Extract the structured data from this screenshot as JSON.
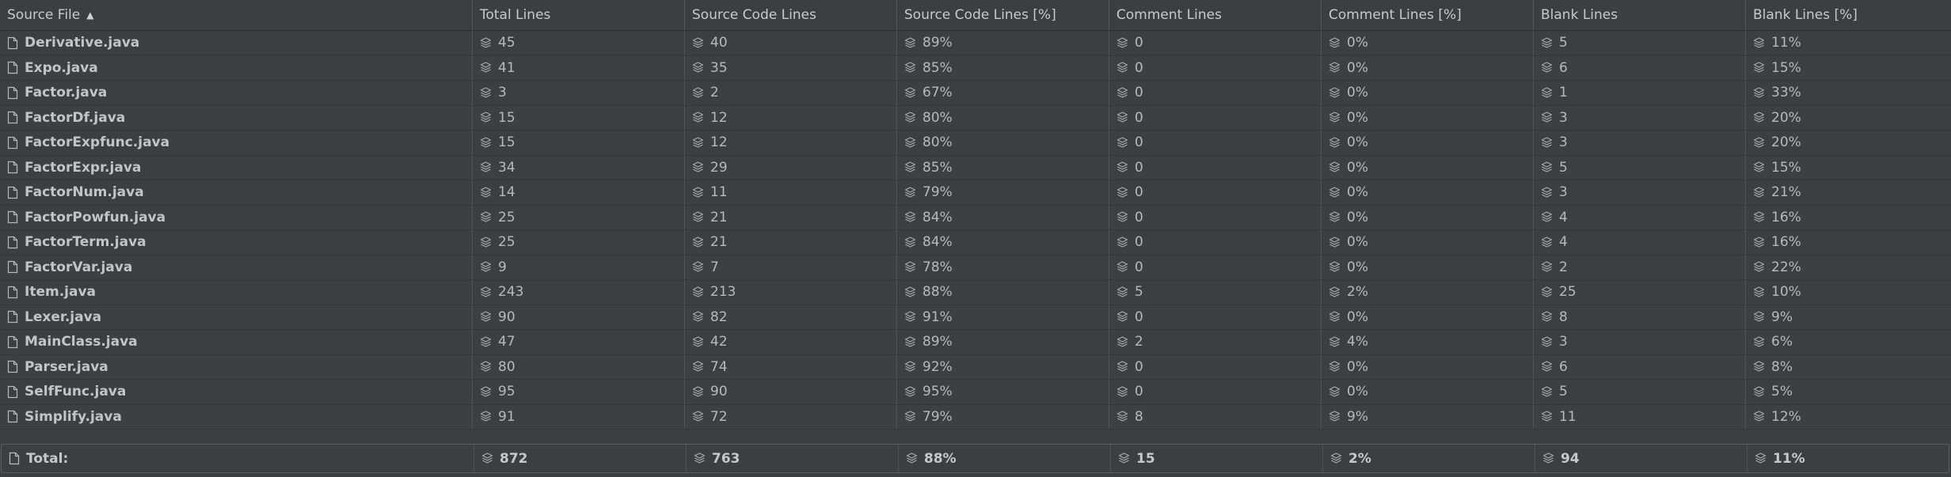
{
  "table": {
    "headers": [
      {
        "label": "Source File",
        "sort": "ascending"
      },
      {
        "label": "Total Lines"
      },
      {
        "label": "Source Code Lines"
      },
      {
        "label": "Source Code Lines [%]"
      },
      {
        "label": "Comment Lines"
      },
      {
        "label": "Comment Lines [%]"
      },
      {
        "label": "Blank Lines"
      },
      {
        "label": "Blank Lines [%]"
      }
    ],
    "rows": [
      {
        "file": "Derivative.java",
        "total": "45",
        "code": "40",
        "code_pct": "89%",
        "comment": "0",
        "comment_pct": "0%",
        "blank": "5",
        "blank_pct": "11%"
      },
      {
        "file": "Expo.java",
        "total": "41",
        "code": "35",
        "code_pct": "85%",
        "comment": "0",
        "comment_pct": "0%",
        "blank": "6",
        "blank_pct": "15%"
      },
      {
        "file": "Factor.java",
        "total": "3",
        "code": "2",
        "code_pct": "67%",
        "comment": "0",
        "comment_pct": "0%",
        "blank": "1",
        "blank_pct": "33%"
      },
      {
        "file": "FactorDf.java",
        "total": "15",
        "code": "12",
        "code_pct": "80%",
        "comment": "0",
        "comment_pct": "0%",
        "blank": "3",
        "blank_pct": "20%"
      },
      {
        "file": "FactorExpfunc.java",
        "total": "15",
        "code": "12",
        "code_pct": "80%",
        "comment": "0",
        "comment_pct": "0%",
        "blank": "3",
        "blank_pct": "20%"
      },
      {
        "file": "FactorExpr.java",
        "total": "34",
        "code": "29",
        "code_pct": "85%",
        "comment": "0",
        "comment_pct": "0%",
        "blank": "5",
        "blank_pct": "15%"
      },
      {
        "file": "FactorNum.java",
        "total": "14",
        "code": "11",
        "code_pct": "79%",
        "comment": "0",
        "comment_pct": "0%",
        "blank": "3",
        "blank_pct": "21%"
      },
      {
        "file": "FactorPowfun.java",
        "total": "25",
        "code": "21",
        "code_pct": "84%",
        "comment": "0",
        "comment_pct": "0%",
        "blank": "4",
        "blank_pct": "16%"
      },
      {
        "file": "FactorTerm.java",
        "total": "25",
        "code": "21",
        "code_pct": "84%",
        "comment": "0",
        "comment_pct": "0%",
        "blank": "4",
        "blank_pct": "16%"
      },
      {
        "file": "FactorVar.java",
        "total": "9",
        "code": "7",
        "code_pct": "78%",
        "comment": "0",
        "comment_pct": "0%",
        "blank": "2",
        "blank_pct": "22%"
      },
      {
        "file": "Item.java",
        "total": "243",
        "code": "213",
        "code_pct": "88%",
        "comment": "5",
        "comment_pct": "2%",
        "blank": "25",
        "blank_pct": "10%"
      },
      {
        "file": "Lexer.java",
        "total": "90",
        "code": "82",
        "code_pct": "91%",
        "comment": "0",
        "comment_pct": "0%",
        "blank": "8",
        "blank_pct": "9%"
      },
      {
        "file": "MainClass.java",
        "total": "47",
        "code": "42",
        "code_pct": "89%",
        "comment": "2",
        "comment_pct": "4%",
        "blank": "3",
        "blank_pct": "6%"
      },
      {
        "file": "Parser.java",
        "total": "80",
        "code": "74",
        "code_pct": "92%",
        "comment": "0",
        "comment_pct": "0%",
        "blank": "6",
        "blank_pct": "8%"
      },
      {
        "file": "SelfFunc.java",
        "total": "95",
        "code": "90",
        "code_pct": "95%",
        "comment": "0",
        "comment_pct": "0%",
        "blank": "5",
        "blank_pct": "5%"
      },
      {
        "file": "Simplify.java",
        "total": "91",
        "code": "72",
        "code_pct": "79%",
        "comment": "8",
        "comment_pct": "9%",
        "blank": "11",
        "blank_pct": "12%"
      }
    ],
    "total": {
      "label": "Total:",
      "total": "872",
      "code": "763",
      "code_pct": "88%",
      "comment": "15",
      "comment_pct": "2%",
      "blank": "94",
      "blank_pct": "11%"
    }
  },
  "icons": {
    "file": "file-icon",
    "metric": "layers-icon"
  },
  "colors": {
    "background": "#3c3f41",
    "text": "#bbbbbb",
    "border": "#515456"
  }
}
